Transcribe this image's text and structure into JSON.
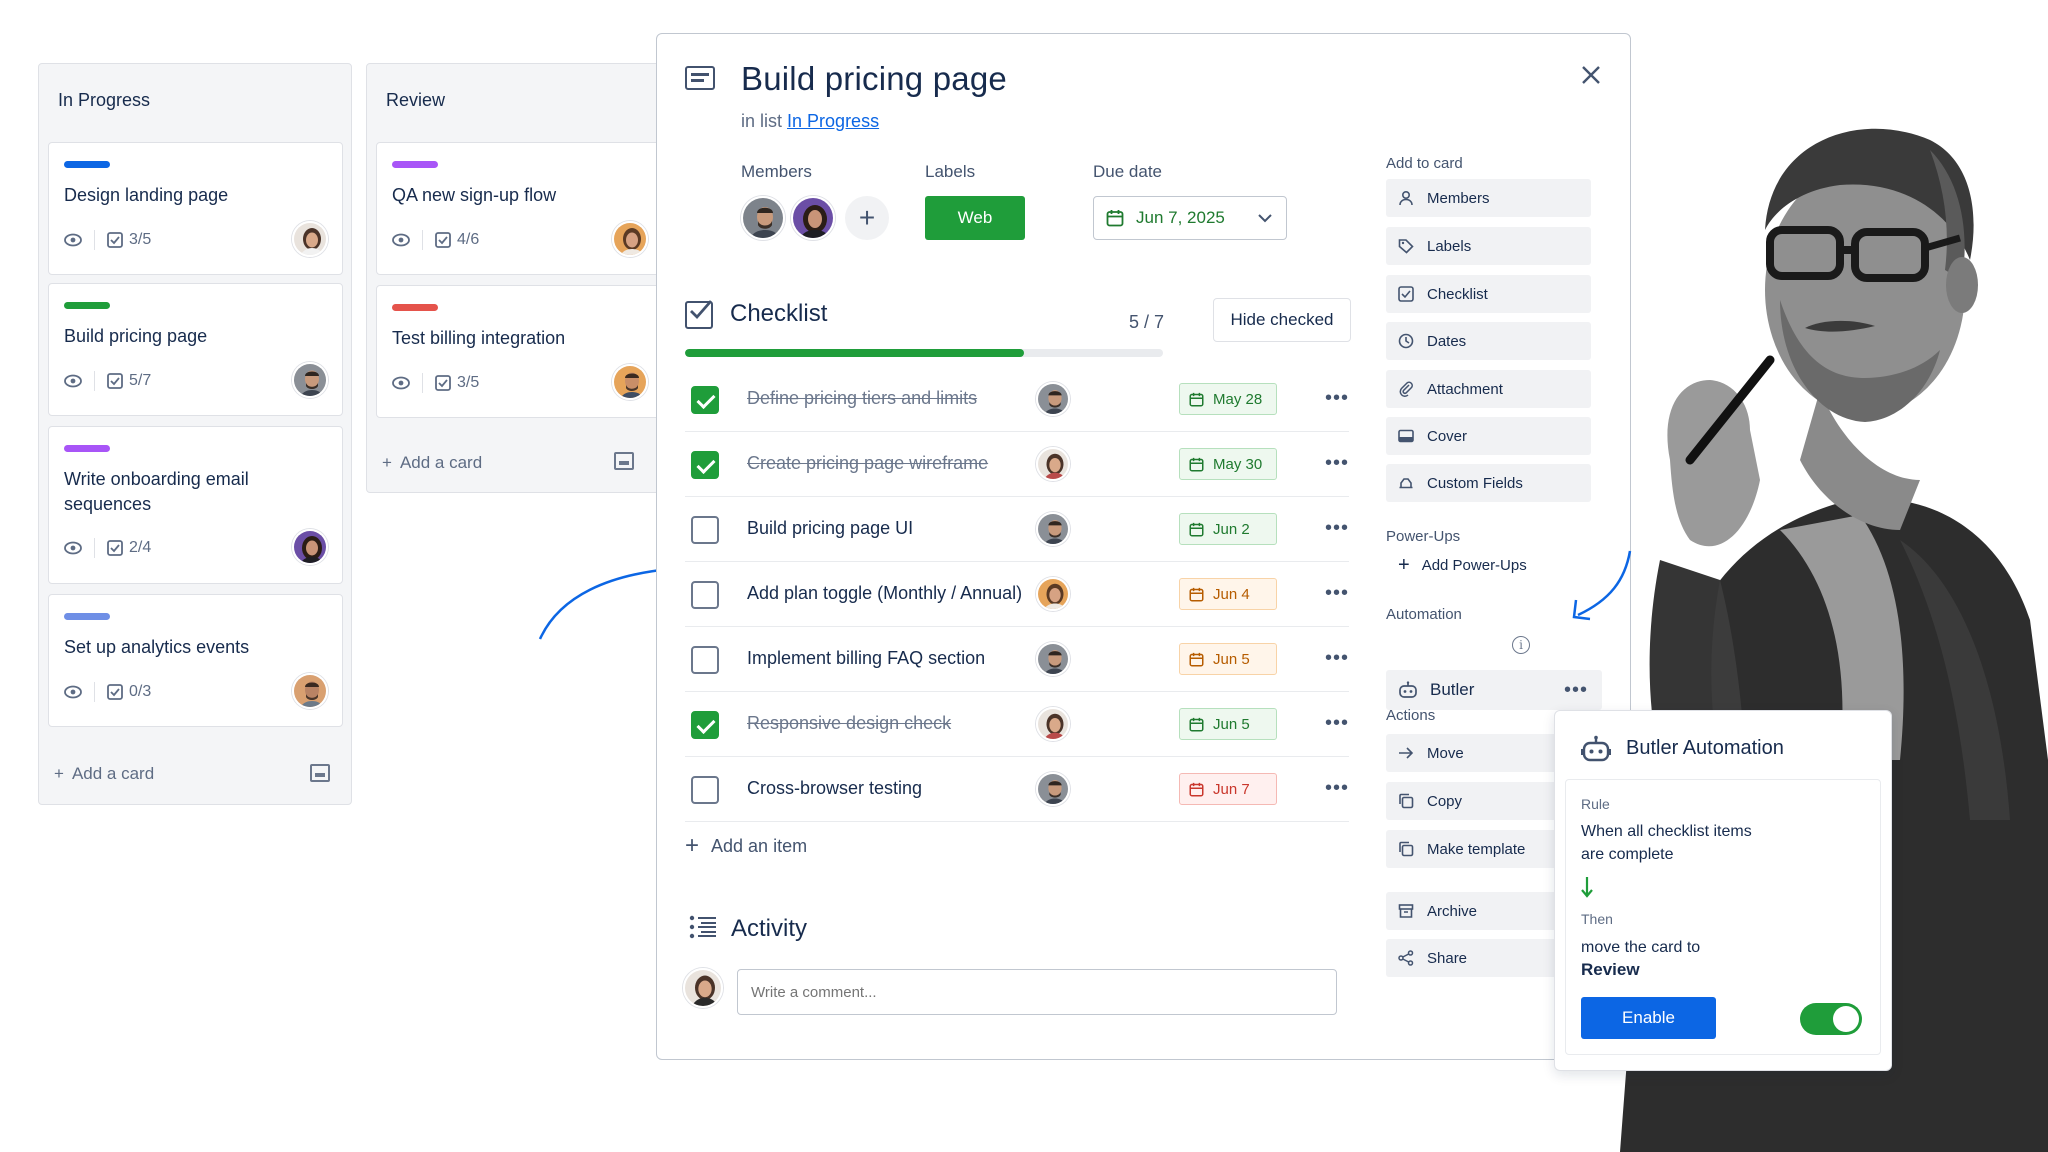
{
  "board": {
    "lists": [
      {
        "title": "In Progress",
        "cards": [
          {
            "title": "Design landing page",
            "label_color": "#0c66e4",
            "checklist": "3/5"
          },
          {
            "title": "Build pricing page",
            "label_color": "#1f9d3a",
            "checklist": "5/7"
          },
          {
            "title": "Write onboarding email sequences",
            "label_color": "#a855f7",
            "checklist": "2/4"
          },
          {
            "title": "Set up analytics events",
            "label_color": "#6f8fe6",
            "checklist": "0/3"
          }
        ],
        "add_card_label": "Add a card"
      },
      {
        "title": "Review",
        "cards": [
          {
            "title": "QA new sign-up flow",
            "label_color": "#a855f7",
            "checklist": "4/6"
          },
          {
            "title": "Test billing integration",
            "label_color": "#e5534b",
            "checklist": "3/5"
          }
        ],
        "add_card_label": "Add a card"
      }
    ]
  },
  "modal": {
    "title": "Build pricing page",
    "in_list_prefix": "in list",
    "in_list_link": "In Progress",
    "members_label": "Members",
    "labels_label": "Labels",
    "label_chip": "Web",
    "label_color": "#1f9d3a",
    "due_label": "Due date",
    "due_value": "Jun 7, 2025",
    "checklist": {
      "title": "Checklist",
      "count": "5 / 7",
      "progress": 0.71,
      "hide_checked_label": "Hide checked",
      "items": [
        {
          "text": "Define pricing tiers and limits",
          "checked": true,
          "date": "May 28",
          "status": "green"
        },
        {
          "text": "Create pricing page wireframe",
          "checked": true,
          "date": "May 30",
          "status": "green"
        },
        {
          "text": "Build pricing page UI",
          "checked": false,
          "date": "Jun 2",
          "status": "green"
        },
        {
          "text": "Add plan toggle (Monthly / Annual)",
          "checked": false,
          "date": "Jun 4",
          "status": "orange"
        },
        {
          "text": "Implement billing FAQ section",
          "checked": false,
          "date": "Jun 5",
          "status": "orange"
        },
        {
          "text": "Responsive design check",
          "checked": true,
          "date": "Jun 5",
          "status": "green"
        },
        {
          "text": "Cross-browser testing",
          "checked": false,
          "date": "Jun 7",
          "status": "red"
        }
      ],
      "add_item_label": "Add an item"
    },
    "activity": {
      "title": "Activity",
      "comment_placeholder": "Write a comment..."
    },
    "sidebar": {
      "add_to_card_heading": "Add to card",
      "add_to_card": [
        "Members",
        "Labels",
        "Checklist",
        "Dates",
        "Attachment",
        "Cover",
        "Custom Fields"
      ],
      "powerups_heading": "Power-Ups",
      "add_powerups_label": "Add Power-Ups",
      "automation_heading": "Automation",
      "butler_label": "Butler",
      "actions_heading": "Actions",
      "actions": [
        "Move",
        "Copy",
        "Make template",
        "Archive",
        "Share"
      ]
    }
  },
  "butler_popup": {
    "title": "Butler Automation",
    "rule_label": "Rule",
    "rule_text_1": "When all checklist items",
    "rule_text_2": "are complete",
    "then_label": "Then",
    "then_text": "move the card to",
    "then_target": "Review",
    "enable_label": "Enable",
    "toggle_on": true
  }
}
